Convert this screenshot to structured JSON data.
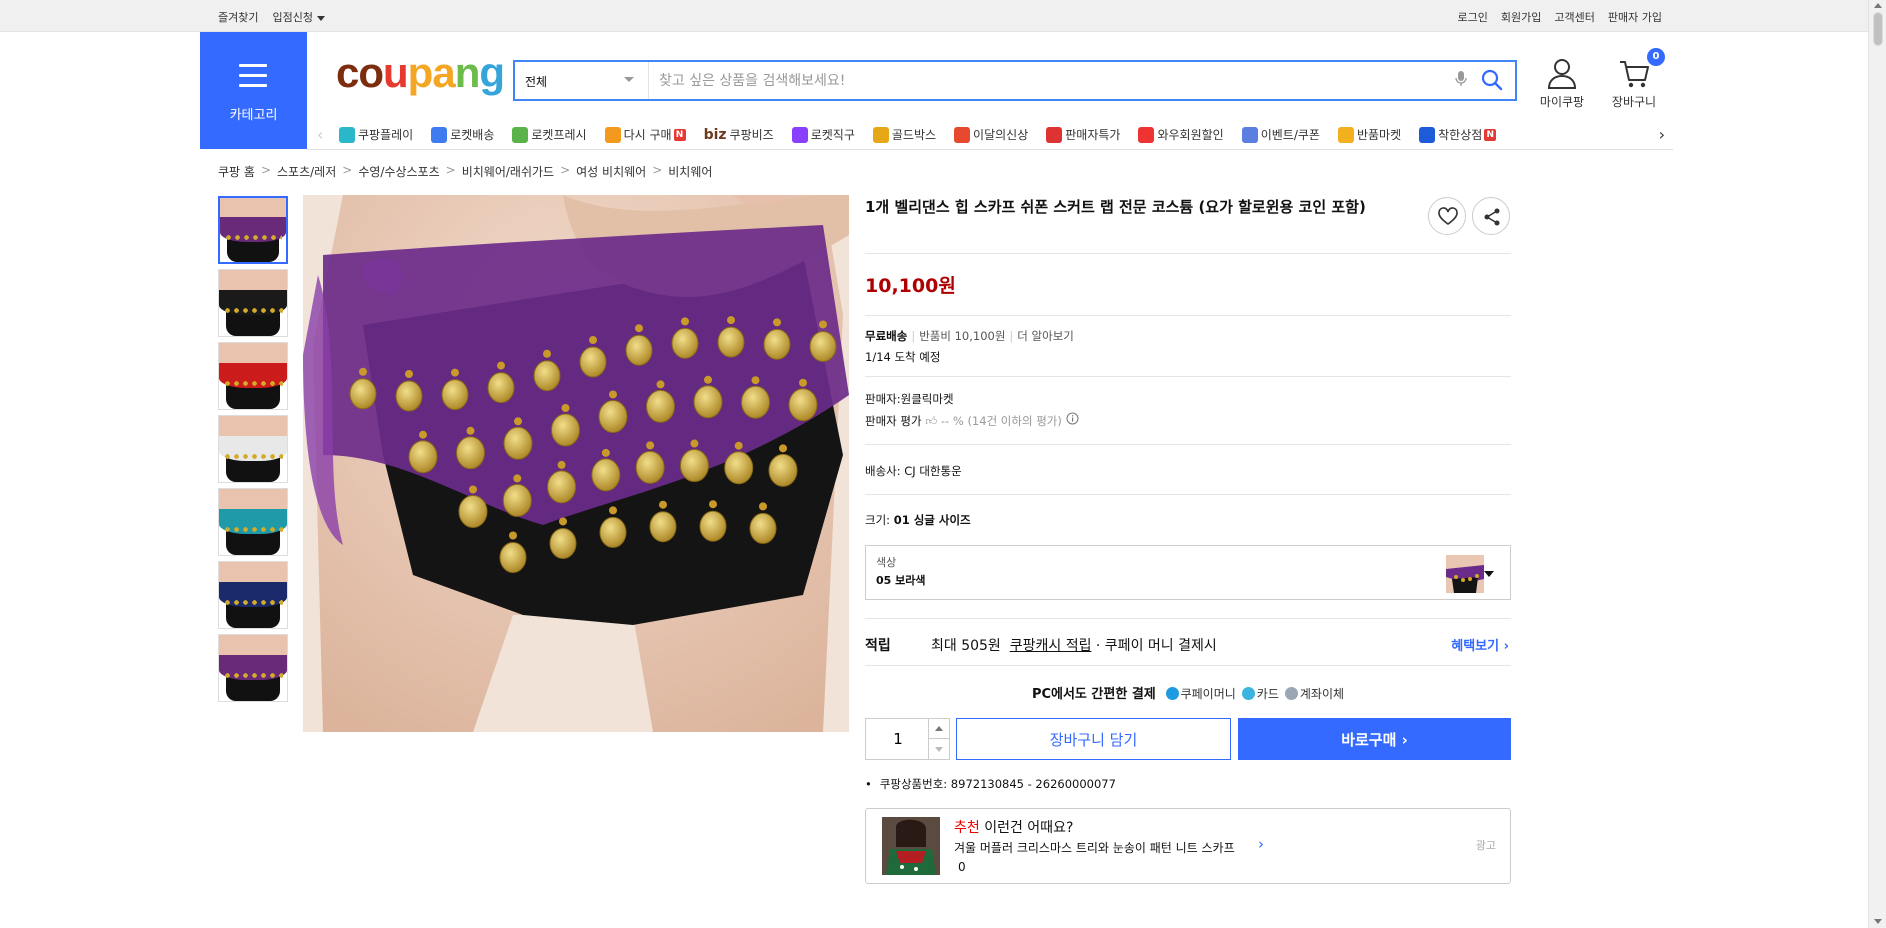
{
  "topbar": {
    "favorites": "즐겨찾기",
    "seller_apply": "입점신청",
    "login": "로그인",
    "signup": "회원가입",
    "customer_center": "고객센터",
    "seller_signup": "판매자 가입"
  },
  "header": {
    "category_label": "카테고리",
    "logo_parts": [
      "co",
      "u",
      "pa",
      "n",
      "g"
    ],
    "search_select": "전체",
    "search_placeholder": "찾고 싶은 상품을 검색해보세요!",
    "mycoupang_label": "마이쿠팡",
    "cart_label": "장바구니",
    "cart_count": "0"
  },
  "catnav": {
    "items": [
      {
        "label": "쿠팡플레이",
        "icon": "play-icon",
        "color": "#2ab7ca"
      },
      {
        "label": "로켓배송",
        "icon": "rocket-icon",
        "color": "#3f7cf0"
      },
      {
        "label": "로켓프레시",
        "icon": "rocket-fresh-icon",
        "color": "#59b24a"
      },
      {
        "label": "다시 구매",
        "icon": "rebuy-bag-icon",
        "color": "#f39a1e",
        "badge": "N"
      },
      {
        "label": "쿠팡비즈",
        "icon": "biz-icon",
        "color": "#6b3b1a",
        "prefix": "biz"
      },
      {
        "label": "로켓직구",
        "icon": "rocket-global-icon",
        "color": "#8a3ffc"
      },
      {
        "label": "골드박스",
        "icon": "gold-box-icon",
        "color": "#e6a817"
      },
      {
        "label": "이달의신상",
        "icon": "new-bag-icon",
        "color": "#e6492d"
      },
      {
        "label": "판매자특가",
        "icon": "seller-deal-icon",
        "color": "#d33"
      },
      {
        "label": "와우회원할인",
        "icon": "wow-icon",
        "color": "#e33"
      },
      {
        "label": "이벤트/쿠폰",
        "icon": "coupon-icon",
        "color": "#5b7fe0"
      },
      {
        "label": "반품마켓",
        "icon": "return-market-icon",
        "color": "#f2b01e"
      },
      {
        "label": "착한상점",
        "icon": "good-store-icon",
        "color": "#1e5bd8",
        "badge": "N"
      }
    ]
  },
  "breadcrumb": [
    "쿠팡 홈",
    "스포츠/레저",
    "수영/수상스포츠",
    "비치웨어/래쉬가드",
    "여성 비치웨어",
    "비치웨어"
  ],
  "thumbnails": [
    {
      "color": "#6a2a7a",
      "active": true
    },
    {
      "color": "#1a1a1a"
    },
    {
      "color": "#cc1b1b"
    },
    {
      "color": "#e8e8e8"
    },
    {
      "color": "#1e9aa8"
    },
    {
      "color": "#1a2a6a"
    },
    {
      "color": "#6a2a7a"
    }
  ],
  "product": {
    "title": "1개 벨리댄스 힙 스카프 쉬폰 스커트 랩 전문 코스튬 (요가 할로윈용 코인 포함)",
    "price": "10,100원",
    "shipping_free": "무료배송",
    "return_fee": "반품비 10,100원",
    "learn_more": "더 알아보기",
    "arrival": "1/14 도착 예정",
    "seller_label": "판매자:",
    "seller_name": "원클릭마켓",
    "rating_label": "판매자 평가",
    "rating_value": "-- % (14건 이하의 평가)",
    "courier_label": "배송사:",
    "courier_name": "CJ 대한통운",
    "size_label": "크기:",
    "size_value": "01 싱글 사이즈",
    "color_label": "색상",
    "color_value": "05 보라색",
    "points_label": "적립",
    "points_max": "최대 505원",
    "points_cash": "쿠팡캐시 적립",
    "points_pay": "· 쿠페이 머니 결제시",
    "benefit_link": "혜택보기",
    "pay_headline": "PC에서도 간편한 결제",
    "pay_methods": [
      {
        "label": "쿠페이머니",
        "icon": "coupay-icon",
        "color": "#1e9ae0"
      },
      {
        "label": "카드",
        "icon": "card-icon",
        "color": "#3cb4e0"
      },
      {
        "label": "계좌이체",
        "icon": "bank-icon",
        "color": "#9aa6b4"
      }
    ],
    "quantity": "1",
    "add_to_cart": "장바구니 담기",
    "buy_now": "바로구매",
    "product_number": "쿠팡상품번호: 8972130845 - 26260000077"
  },
  "recommend": {
    "headline_red": "추천",
    "headline_rest": " 이런건 어때요?",
    "item_name": "겨울 머플러 크리스마스 트리와 눈송이 패턴 니트 스카프",
    "count": "0",
    "ad_label": "광고"
  }
}
